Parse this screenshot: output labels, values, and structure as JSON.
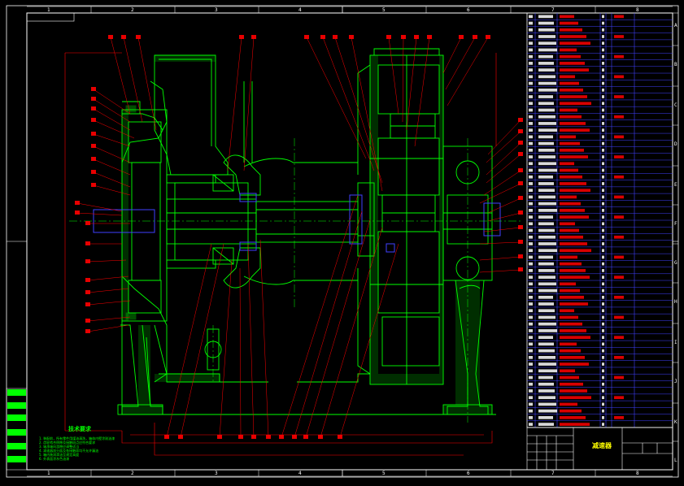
{
  "drawing": {
    "title": "减速器",
    "notes_title": "技术要求",
    "notes": [
      "1. 装配前，所有零件用煤油清洗，箱体内壁涂耐油漆",
      "2. 齿轮啮合侧隙及接触斑点应符合要求",
      "3. 轴承轴向游隙应调整适当",
      "4. 减速器剖分面及各接触面均不允许漏油",
      "5. 箱内装润滑油至规定高度",
      "6. 外表面涂灰色油漆"
    ],
    "column_labels": [
      "1",
      "2",
      "3",
      "4",
      "5",
      "6",
      "7",
      "8"
    ],
    "row_labels": [
      "A",
      "B",
      "C",
      "D",
      "E",
      "F",
      "G",
      "H",
      "I",
      "J",
      "K",
      "L"
    ],
    "colors": {
      "frame": "#ffffff",
      "section": "#00ff00",
      "leader": "#ff0000",
      "table": "#0000ff",
      "text_yellow": "#ffff00",
      "center": "#00ff00"
    }
  }
}
